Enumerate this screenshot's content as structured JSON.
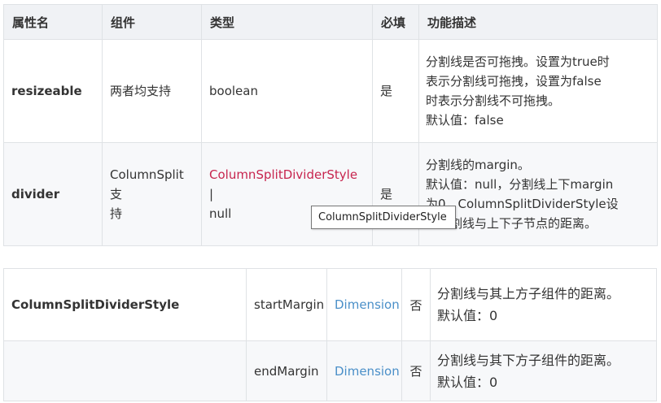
{
  "top_table": {
    "headers": [
      "属性名",
      "组件",
      "类型",
      "必填",
      "功能描述"
    ],
    "rows": [
      {
        "name": "resizeable",
        "component": "两者均支持",
        "type_text": "boolean",
        "required": "是",
        "desc_lines": [
          "分割线是否可拖拽。设置为true时",
          "表示分割线可拖拽，设置为false",
          "时表示分割线不可拖拽。",
          "默认值：false"
        ]
      },
      {
        "name": "divider",
        "component_lines": [
          "ColumnSplit支",
          "持"
        ],
        "type_link": "ColumnSplitDividerStyle",
        "type_suffix": " |",
        "type_line2": "null",
        "required": "是",
        "desc_lines": [
          "分割线的margin。",
          "默认值：null，分割线上下margin",
          "为0，ColumnSplitDividerStyle设",
          "置分割线与上下子节点的距离。"
        ]
      }
    ]
  },
  "tooltip": "ColumnSplitDividerStyle",
  "bottom_table": {
    "name": "ColumnSplitDividerStyle",
    "rows": [
      {
        "param": "startMargin",
        "type_link": "Dimension",
        "required": "否",
        "desc_lines": [
          "分割线与其上方子组件的距离。",
          "默认值：0"
        ]
      },
      {
        "param": "endMargin",
        "type_link": "Dimension",
        "required": "否",
        "desc_lines": [
          "分割线与其下方子组件的距离。",
          "默认值：0"
        ]
      }
    ]
  },
  "colors": {
    "header_bg": "#f0f2f5",
    "alt_row_bg": "#f7f8fa",
    "border": "#dfe2e5",
    "red_link": "#c7254e",
    "blue_link": "#4a8fc8"
  }
}
